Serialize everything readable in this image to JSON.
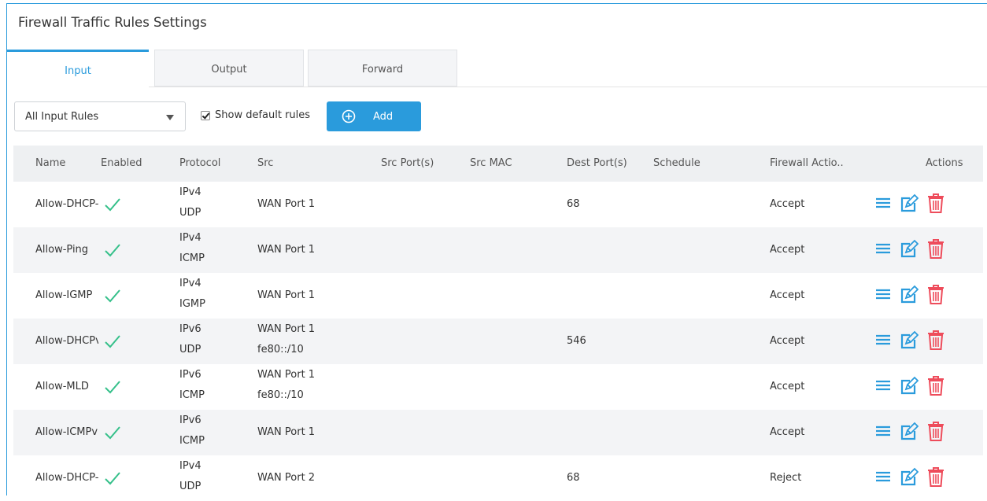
{
  "page": {
    "title": "Firewall Traffic Rules Settings"
  },
  "tabs": [
    {
      "label": "Input",
      "active": true
    },
    {
      "label": "Output",
      "active": false
    },
    {
      "label": "Forward",
      "active": false
    }
  ],
  "toolbar": {
    "filter_selected": "All Input Rules",
    "show_default_label": "Show default rules",
    "show_default_checked": true,
    "add_label": "Add"
  },
  "table": {
    "headers": {
      "name": "Name",
      "enabled": "Enabled",
      "protocol": "Protocol",
      "src": "Src",
      "src_ports": "Src Port(s)",
      "src_mac": "Src MAC",
      "dest_ports": "Dest Port(s)",
      "schedule": "Schedule",
      "action": "Firewall Actio..",
      "actions": "Actions"
    },
    "rows": [
      {
        "name": "Allow-DHCP-",
        "ip": "IPv4",
        "proto": "UDP",
        "src1": "WAN Port 1",
        "src2": "",
        "dest": "68",
        "action": "Accept"
      },
      {
        "name": "Allow-Ping",
        "ip": "IPv4",
        "proto": "ICMP",
        "src1": "WAN Port 1",
        "src2": "",
        "dest": "",
        "action": "Accept"
      },
      {
        "name": "Allow-IGMP",
        "ip": "IPv4",
        "proto": "IGMP",
        "src1": "WAN Port 1",
        "src2": "",
        "dest": "",
        "action": "Accept"
      },
      {
        "name": "Allow-DHCPv",
        "ip": "IPv6",
        "proto": "UDP",
        "src1": "WAN Port 1",
        "src2": "fe80::/10",
        "dest": "546",
        "action": "Accept"
      },
      {
        "name": "Allow-MLD",
        "ip": "IPv6",
        "proto": "ICMP",
        "src1": "WAN Port 1",
        "src2": "fe80::/10",
        "dest": "",
        "action": "Accept"
      },
      {
        "name": "Allow-ICMPv",
        "ip": "IPv6",
        "proto": "ICMP",
        "src1": "WAN Port 1",
        "src2": "",
        "dest": "",
        "action": "Accept"
      },
      {
        "name": "Allow-DHCP-",
        "ip": "IPv4",
        "proto": "UDP",
        "src1": "WAN Port 2",
        "src2": "",
        "dest": "68",
        "action": "Reject"
      }
    ],
    "icons": {
      "enabled": "checkmark-icon",
      "details": "list-icon",
      "edit": "edit-icon",
      "delete": "trash-icon"
    }
  },
  "colors": {
    "accent": "#2a9bdc",
    "check": "#35c08a",
    "delete": "#ee4c5b",
    "header_bg": "#eef0f2",
    "alt_row": "#f3f4f6"
  }
}
